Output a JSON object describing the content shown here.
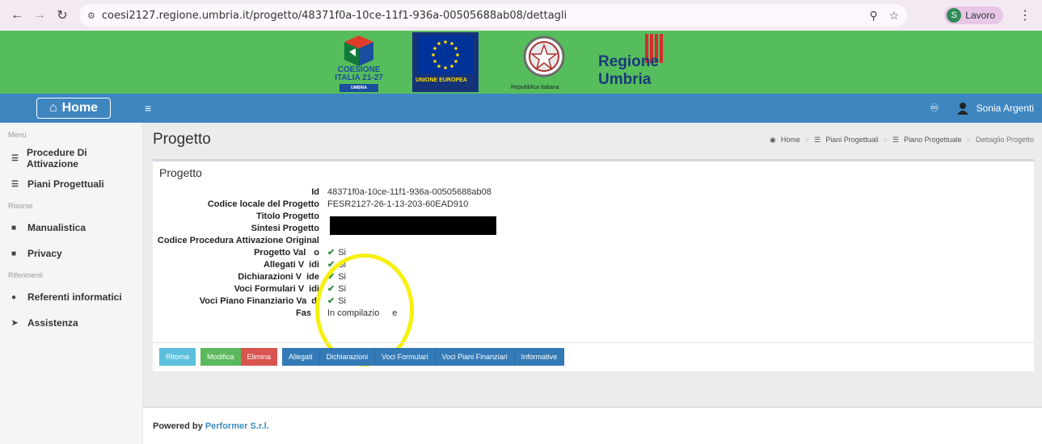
{
  "browser": {
    "url": "coesi2127.regione.umbria.it/progetto/48371f0a-10ce-11f1-936a-00505688ab08/dettagli",
    "profile_initial": "S",
    "profile_name": "Lavoro"
  },
  "banner": {
    "coesione_line1": "COESIONE",
    "coesione_line2": "ITALIA 21-27",
    "coesione_line3": "UMBRIA",
    "eu_label": "UNIONE EUROPEA",
    "repubblica_label": "Repubblica Italiana",
    "umbria_label": "Regione Umbria"
  },
  "topnav": {
    "home_label": "Home",
    "user_name": "Sonia Argenti"
  },
  "sidebar": {
    "section_menu": "Menù",
    "section_risorse": "Risorse",
    "section_riferimenti": "Riferimenti",
    "items": [
      {
        "label": "Procedure Di Attivazione"
      },
      {
        "label": "Piani Progettuali"
      },
      {
        "label": "Manualistica"
      },
      {
        "label": "Privacy"
      },
      {
        "label": "Referenti informatici"
      },
      {
        "label": "Assistenza"
      }
    ]
  },
  "page": {
    "title": "Progetto",
    "breadcrumb": [
      "Home",
      "Piani Progettuali",
      "Piano Progettuale",
      "Dettaglio Progetto"
    ],
    "box_title": "Progetto"
  },
  "details": {
    "id_label": "Id",
    "id_value": "48371f0a-10ce-11f1-936a-00505688ab08",
    "codice_label": "Codice locale del Progetto",
    "codice_value": "FESR2127-26-1-13-203-60EAD910",
    "titolo_label": "Titolo Progetto",
    "sintesi_label": "Sintesi Progetto",
    "proc_label": "Codice Procedura Attivazione Original",
    "valido_label": "Progetto Val",
    "valido_label_tail": "o",
    "valido_value": "Si",
    "allegati_label": "Allegati V",
    "allegati_label_tail": "idi",
    "allegati_value": "Si",
    "dich_label": "Dichiarazioni V",
    "dich_label_tail": "ide",
    "dich_value": "Si",
    "voci_label": "Voci Formulari V",
    "voci_label_tail": "idi",
    "voci_value": "Si",
    "piano_label": "Voci Piano Finanziario Va",
    "piano_label_tail": "di",
    "piano_value": "Si",
    "fase_label": "Fas",
    "fase_value": "In compilazio",
    "fase_value_tail": "e"
  },
  "buttons": {
    "ritorna": "Ritorna",
    "modifica": "Modifica",
    "elimina": "Elimina",
    "allegati": "Allegati",
    "dichiarazioni": "Dichiarazioni",
    "voci_formulari": "Voci Formulari",
    "voci_piani": "Voci Piani Finanziari",
    "informative": "Informative"
  },
  "footer": {
    "powered_by": "Powered by",
    "company": "Performer S.r.l."
  },
  "colors": {
    "banner_green": "#56bd5c",
    "nav_blue": "#3e86c0",
    "highlight_yellow": "#f6f00c"
  }
}
